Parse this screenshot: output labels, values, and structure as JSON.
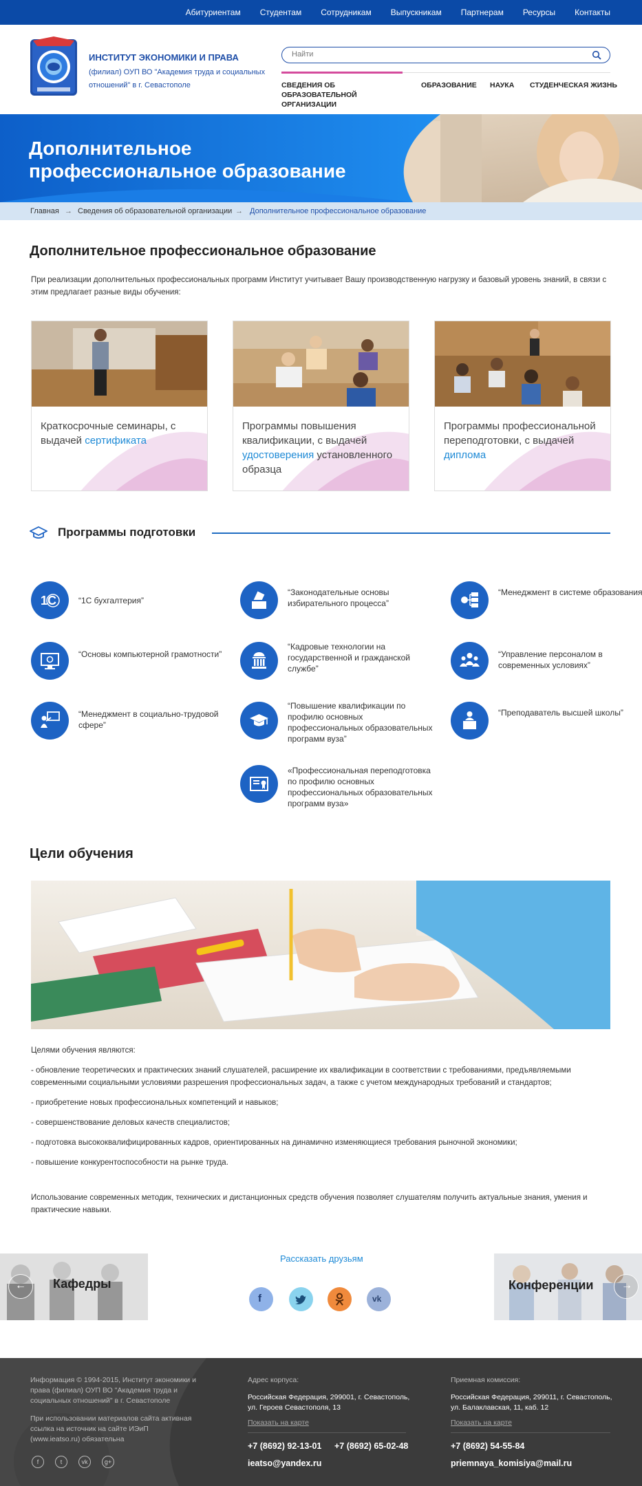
{
  "topnav": {
    "items": [
      "Абитуриентам",
      "Студентам",
      "Сотрудникам",
      "Выпускникам",
      "Партнерам",
      "Ресурсы",
      "Контакты"
    ]
  },
  "header": {
    "org_name": "ИНСТИТУТ ЭКОНОМИКИ И ПРАВА",
    "org_sub": "(филиал) ОУП ВО \"Академия труда и социальных отношений\" в г. Севастополе",
    "search_placeholder": "Найти",
    "menu": [
      {
        "label": "СВЕДЕНИЯ ОБ ОБРАЗОВАТЕЛЬНОЙ ОРГАНИЗАЦИИ",
        "active": true
      },
      {
        "label": "ОБРАЗОВАНИЕ"
      },
      {
        "label": "НАУКА"
      },
      {
        "label": "СТУДЕНЧЕСКАЯ ЖИЗНЬ"
      }
    ]
  },
  "hero": {
    "title_line1": "Дополнительное",
    "title_line2": "профессиональное образование"
  },
  "breadcrumb": {
    "items": [
      "Главная",
      "Сведения об образовательной организации",
      "Дополнительное профессиональное образование"
    ]
  },
  "page": {
    "title": "Дополнительное профессиональное образование",
    "intro": "При реализации дополнительных профессиональных программ Институт учитывает Вашу производственную нагрузку и базовый уровень знаний, в связи с этим предлагает разные виды обучения:"
  },
  "cards": [
    {
      "text": "Краткосрочные семинары, с выдачей ",
      "link": "сертификата",
      "after": ""
    },
    {
      "text": "Программы повышения квалификации, с выдачей ",
      "link": "удостоверения",
      "after": " установленного образца"
    },
    {
      "text": "Программы профессиональной переподготовки, с выдачей ",
      "link": "диплома",
      "after": ""
    }
  ],
  "programs": {
    "title": "Программы подготовки",
    "items": [
      {
        "label": "“1С бухгалтерия”",
        "icon": "1c-icon"
      },
      {
        "label": "“Законодательные основы избирательного процесса”",
        "icon": "ballot-icon"
      },
      {
        "label": "“Менеджмент в системе образования”",
        "icon": "org-chart-icon"
      },
      {
        "label": "“Основы компьютерной грамотности”",
        "icon": "computer-icon"
      },
      {
        "label": "“Кадровые технологии на государственной и гражданской службе”",
        "icon": "government-building-icon"
      },
      {
        "label": "“Управление персоналом в современных условиях”",
        "icon": "people-icon"
      },
      {
        "label": "“Менеджмент в социально-трудовой сфере”",
        "icon": "presenter-icon"
      },
      {
        "label": "“Повышение квалификации по профилю основных профессиональных образовательных программ вуза”",
        "icon": "graduation-cap-icon"
      },
      {
        "label": "“Преподаватель высшей школы”",
        "icon": "lecturer-icon"
      },
      {
        "label": "«Профессиональная переподготовка по профилю основных профессиональных образовательных программ вуза»",
        "icon": "certificate-icon"
      }
    ]
  },
  "goals": {
    "title": "Цели обучения",
    "paragraphs": [
      "Целями обучения являются:",
      "- обновление теоретических и практических знаний слушателей, расширение их квалификации в соответствии с требованиями, предъявляемыми современными социальными условиями разрешения профессиональных задач, а также с учетом международных требований и стандартов;",
      "- приобретение новых профессиональных компетенций и навыков;",
      "- совершенствование деловых качеств специалистов;",
      "- подготовка высококвалифицированных кадров, ориентированных на динамично изменяющиеся требования рыночной экономики;",
      "- повышение конкурентоспособности на рынке труда."
    ],
    "closing": "Использование современных методик, технических и дистанционных средств обучения позволяет слушателям получить актуальные знания, умения и практические навыки."
  },
  "share": {
    "title": "Рассказать друзьям",
    "left_promo": "Кафедры",
    "right_promo": "Конференции",
    "networks": [
      {
        "name": "facebook",
        "color": "#8fb2e8",
        "glyph": "f"
      },
      {
        "name": "twitter",
        "color": "#8ad3ee",
        "glyph": "t"
      },
      {
        "name": "odnoklassniki",
        "color": "#f08a3c",
        "glyph": "ok"
      },
      {
        "name": "vk",
        "color": "#9cb2da",
        "glyph": "vk"
      }
    ]
  },
  "footer": {
    "copyright": "Информация © 1994-2015, Институт экономики и права (филиал) ОУП ВО \"Академия труда и социальных отношений\" в г. Севастополе",
    "notice": "При использовании материалов сайта активная ссылка на источник на сайте ИЭиП (www.ieatso.ru) обязательна",
    "campus_label": "Адрес корпуса:",
    "campus_address": "Российская Федерация, 299001, г. Севастополь, ул. Героев Севастополя, 13",
    "campus_map": "Показать на карте",
    "campus_phone1": "+7 (8692) 92-13-01",
    "campus_phone2": "+7 (8692) 65-02-48",
    "campus_email": "ieatso@yandex.ru",
    "admissions_label": "Приемная комиссия:",
    "admissions_address": "Российская Федерация, 299011, г. Севастополь, ул. Балаклавская, 11, каб. 12",
    "admissions_map": "Показать на карте",
    "admissions_phone": "+7 (8692) 54-55-84",
    "admissions_email": "priemnaya_komisiya@mail.ru",
    "social": [
      "facebook",
      "twitter",
      "vk",
      "google-plus"
    ]
  },
  "colors": {
    "brand_blue": "#0b4aa7",
    "accent_pink": "#d44b9c",
    "link_blue": "#1e8ad6",
    "icon_blue": "#1d63c4",
    "footer_bg": "#3b3b3b"
  }
}
